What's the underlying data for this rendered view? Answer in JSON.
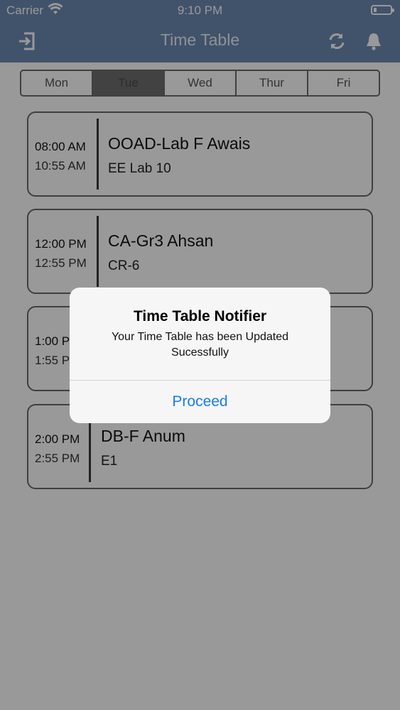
{
  "status_bar": {
    "carrier": "Carrier",
    "time": "9:10 PM"
  },
  "nav": {
    "title": "Time Table",
    "icons": [
      "logout-icon",
      "refresh-icon",
      "bell-icon"
    ]
  },
  "days": {
    "items": [
      "Mon",
      "Tue",
      "Wed",
      "Thur",
      "Fri"
    ],
    "selected": "Tue"
  },
  "classes": [
    {
      "start": "08:00 AM",
      "end": "10:55 AM",
      "course": "OOAD-Lab F Awais",
      "room": "EE Lab 10"
    },
    {
      "start": "12:00 PM",
      "end": "12:55 PM",
      "course": "CA-Gr3 Ahsan",
      "room": "CR-6"
    },
    {
      "start": "1:00 P",
      "end": "1:55 P",
      "course": "",
      "room": ""
    },
    {
      "start": "2:00 PM",
      "end": "2:55 PM",
      "course": "DB-F Anum",
      "room": "E1"
    }
  ],
  "alert": {
    "title": "Time Table Notifier",
    "message": "Your Time Table has been Updated Sucessfully",
    "button": "Proceed"
  },
  "colors": {
    "nav_bar": "#6d89b3",
    "alert_button": "#1a7cf0",
    "dim_overlay": "rgba(0,0,0,0.40)"
  }
}
